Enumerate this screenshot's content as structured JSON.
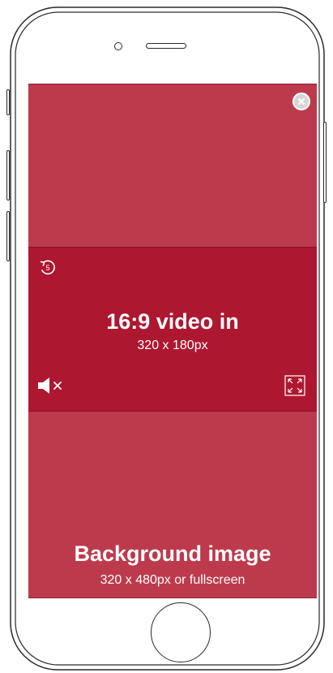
{
  "ad": {
    "video": {
      "title": "16:9 video in",
      "size": "320 x 180px",
      "replay_seconds": "5"
    },
    "background": {
      "title": "Background image",
      "size": "320 x 480px or fullscreen"
    }
  },
  "icons": {
    "close": "close-icon",
    "replay": "replay-icon",
    "mute": "mute-icon",
    "fullscreen": "fullscreen-icon"
  },
  "colors": {
    "background_area": "#bd3a4d",
    "video_area": "#ae1730",
    "text": "#ffffff",
    "close_button": "#d6d6d6",
    "phone_outline": "#2a2a2a"
  }
}
